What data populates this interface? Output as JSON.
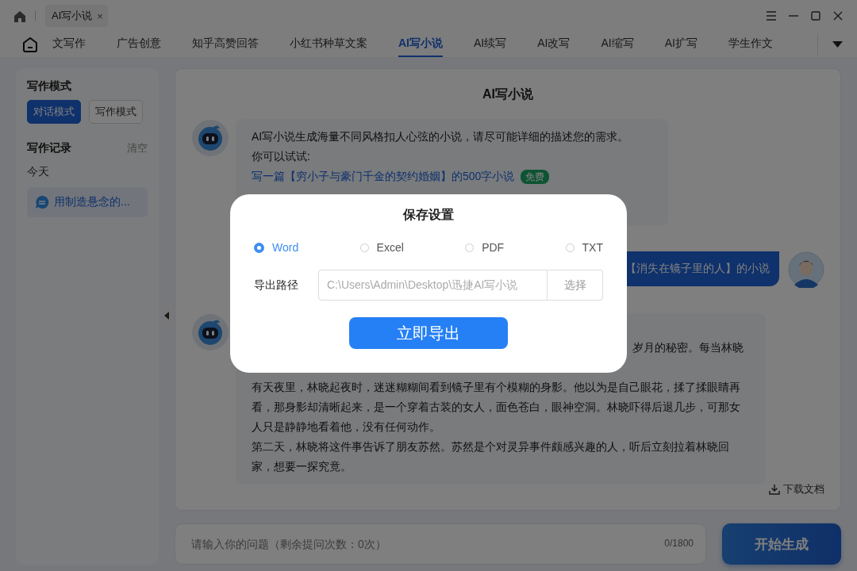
{
  "window": {
    "tab_title": "AI写小说",
    "tab_close": "×"
  },
  "nav": {
    "tabs": [
      {
        "label": "文写作",
        "selected": false
      },
      {
        "label": "广告创意",
        "selected": false
      },
      {
        "label": "知乎高赞回答",
        "selected": false
      },
      {
        "label": "小红书种草文案",
        "selected": false
      },
      {
        "label": "AI写小说",
        "selected": true
      },
      {
        "label": "AI续写",
        "selected": false
      },
      {
        "label": "AI改写",
        "selected": false
      },
      {
        "label": "AI缩写",
        "selected": false
      },
      {
        "label": "AI扩写",
        "selected": false
      },
      {
        "label": "学生作文",
        "selected": false
      }
    ]
  },
  "sidebar": {
    "mode_title": "写作模式",
    "modes": [
      {
        "label": "对话模式",
        "selected": true
      },
      {
        "label": "写作模式",
        "selected": false
      }
    ],
    "history_title": "写作记录",
    "clear": "清空",
    "group": "今天",
    "items": [
      {
        "label": "用制造悬念的...",
        "selected": true
      }
    ]
  },
  "chat": {
    "title": "AI写小说",
    "messages": [
      {
        "kind": "bot",
        "lines": [
          {
            "kind": "text",
            "text": "AI写小说生成海量不同风格扣人心弦的小说，请尽可能详细的描述您的需求。"
          },
          {
            "kind": "text",
            "text": "你可以试试:"
          },
          {
            "kind": "link",
            "text": "写一篇【穷小子与豪门千金的契约婚姻】的500字小说",
            "badge": "免费"
          }
        ]
      },
      {
        "kind": "user",
        "text": "【消失在镜子里的人】的小说"
      },
      {
        "kind": "bot",
        "partial": "岁月的秘密。每当林晓",
        "paragraphs": [
          "有天夜里，林晓起夜时，迷迷糊糊间看到镜子里有个模糊的身影。他以为是自己眼花，揉了揉眼睛再看，那身影却清晰起来，是一个穿着古装的女人，面色苍白，眼神空洞。林晓吓得后退几步，可那女人只是静静地看着他，没有任何动作。",
          "第二天，林晓将这件事告诉了朋友苏然。苏然是个对灵异事件颇感兴趣的人，听后立刻拉着林晓回家，想要一探究竟。"
        ],
        "action": "下载文档"
      }
    ]
  },
  "input": {
    "placeholder": "请输入你的问题（剩余提问次数：0次）",
    "counter": "0/1800",
    "button": "开始生成"
  },
  "dialog": {
    "title": "保存设置",
    "formats": [
      {
        "label": "Word",
        "selected": true
      },
      {
        "label": "Excel",
        "selected": false
      },
      {
        "label": "PDF",
        "selected": false
      },
      {
        "label": "TXT",
        "selected": false
      }
    ],
    "path_label": "导出路径",
    "path": "C:\\Users\\Admin\\Desktop\\迅捷AI写小说",
    "choose": "选择",
    "export": "立即导出"
  }
}
